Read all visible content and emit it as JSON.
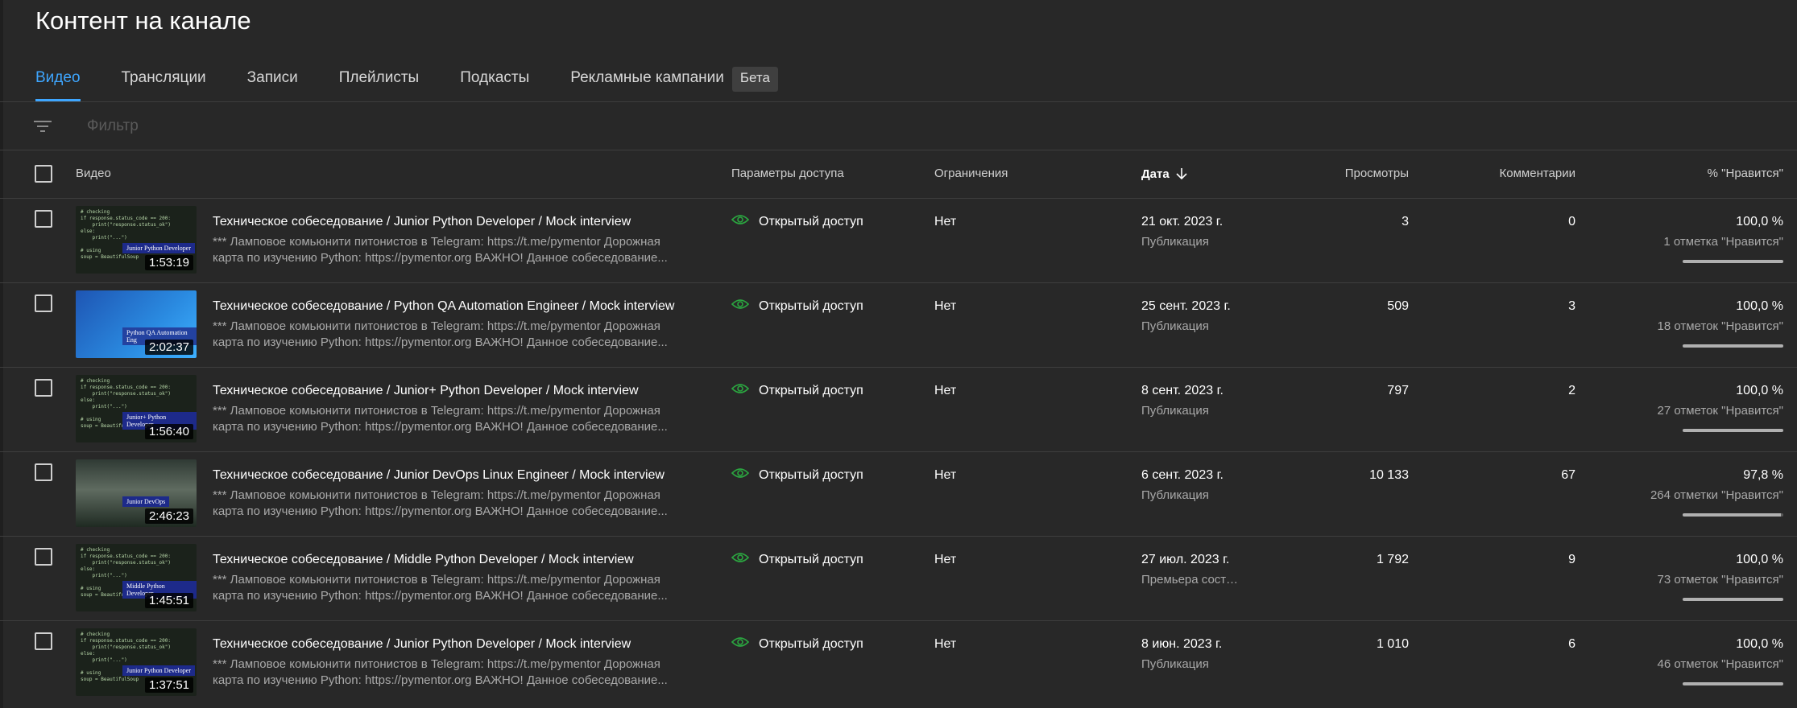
{
  "page": {
    "title": "Контент на канале"
  },
  "tabs": [
    {
      "label": "Видео",
      "active": true
    },
    {
      "label": "Трансляции",
      "active": false
    },
    {
      "label": "Записи",
      "active": false
    },
    {
      "label": "Плейлисты",
      "active": false
    },
    {
      "label": "Подкасты",
      "active": false
    },
    {
      "label": "Рекламные кампании",
      "active": false,
      "badge": "Бета"
    }
  ],
  "filter": {
    "placeholder": "Фильтр",
    "icon": "filter-icon"
  },
  "columns": {
    "video": "Видео",
    "visibility": "Параметры доступа",
    "restrictions": "Ограничения",
    "date": "Дата",
    "views": "Просмотры",
    "comments": "Комментарии",
    "likes": "% \"Нравится\""
  },
  "sort": {
    "column": "date",
    "direction": "descending",
    "icon": "arrow-down-icon"
  },
  "colors": {
    "accent": "#3ea6ff",
    "visibility_icon": "#2ba640",
    "background": "#282828"
  },
  "rows": [
    {
      "title": "Техническое собеседование / Junior Python Developer / Mock interview",
      "description": "*** Ламповое комьюнити питонистов в Telegram: https://t.me/pymentor Дорожная карта по изучению Python: https://pymentor.org ВАЖНО! Данное собеседование...",
      "duration": "1:53:19",
      "thumb_label": "Junior Python Developer",
      "thumb_style": "code",
      "visibility": "Открытый доступ",
      "restrictions": "Нет",
      "date": "21 окт. 2023 г.",
      "status": "Публикация",
      "views": "3",
      "comments": "0",
      "likes_pct": "100,0 %",
      "likes_count": "1 отметка \"Нравится\"",
      "likes_ratio": 1.0
    },
    {
      "title": "Техническое собеседование / Python QA Automation Engineer / Mock interview",
      "description": "*** Ламповое комьюнити питонистов в Telegram: https://t.me/pymentor Дорожная карта по изучению Python: https://pymentor.org ВАЖНО! Данное собеседование...",
      "duration": "2:02:37",
      "thumb_label": "Python QA Automation Eng",
      "thumb_style": "blue",
      "visibility": "Открытый доступ",
      "restrictions": "Нет",
      "date": "25 сент. 2023 г.",
      "status": "Публикация",
      "views": "509",
      "comments": "3",
      "likes_pct": "100,0 %",
      "likes_count": "18 отметок \"Нравится\"",
      "likes_ratio": 1.0
    },
    {
      "title": "Техническое собеседование / Junior+ Python Developer / Mock interview",
      "description": "*** Ламповое комьюнити питонистов в Telegram: https://t.me/pymentor Дорожная карта по изучению Python: https://pymentor.org ВАЖНО! Данное собеседование...",
      "duration": "1:56:40",
      "thumb_label": "Junior+ Python Developer",
      "thumb_style": "code",
      "visibility": "Открытый доступ",
      "restrictions": "Нет",
      "date": "8 сент. 2023 г.",
      "status": "Публикация",
      "views": "797",
      "comments": "2",
      "likes_pct": "100,0 %",
      "likes_count": "27 отметок \"Нравится\"",
      "likes_ratio": 1.0
    },
    {
      "title": "Техническое собеседование / Junior DevOps Linux Engineer / Mock interview",
      "description": "*** Ламповое комьюнити питонистов в Telegram: https://t.me/pymentor Дорожная карта по изучению Python: https://pymentor.org ВАЖНО! Данное собеседование...",
      "duration": "2:46:23",
      "thumb_label": "Junior DevOps",
      "thumb_style": "server",
      "visibility": "Открытый доступ",
      "restrictions": "Нет",
      "date": "6 сент. 2023 г.",
      "status": "Публикация",
      "views": "10 133",
      "comments": "67",
      "likes_pct": "97,8 %",
      "likes_count": "264 отметки \"Нравится\"",
      "likes_ratio": 0.978
    },
    {
      "title": "Техническое собеседование / Middle Python Developer / Mock interview",
      "description": "*** Ламповое комьюнити питонистов в Telegram: https://t.me/pymentor Дорожная карта по изучению Python: https://pymentor.org ВАЖНО! Данное собеседование...",
      "duration": "1:45:51",
      "thumb_label": "Middle Python Developer",
      "thumb_style": "code",
      "visibility": "Открытый доступ",
      "restrictions": "Нет",
      "date": "27 июл. 2023 г.",
      "status": "Премьера состоялась",
      "views": "1 792",
      "comments": "9",
      "likes_pct": "100,0 %",
      "likes_count": "73 отметок \"Нравится\"",
      "likes_ratio": 1.0
    },
    {
      "title": "Техническое собеседование / Junior Python Developer / Mock interview",
      "description": "*** Ламповое комьюнити питонистов в Telegram: https://t.me/pymentor Дорожная карта по изучению Python: https://pymentor.org ВАЖНО! Данное собеседование...",
      "duration": "1:37:51",
      "thumb_label": "Junior Python Developer",
      "thumb_style": "code",
      "visibility": "Открытый доступ",
      "restrictions": "Нет",
      "date": "8 июн. 2023 г.",
      "status": "Публикация",
      "views": "1 010",
      "comments": "6",
      "likes_pct": "100,0 %",
      "likes_count": "46 отметок \"Нравится\"",
      "likes_ratio": 1.0
    }
  ]
}
